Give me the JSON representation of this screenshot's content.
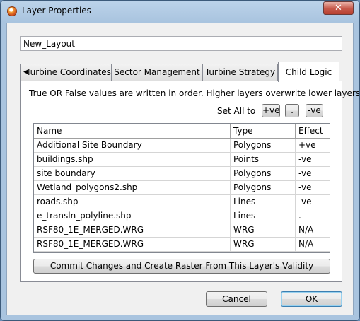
{
  "window": {
    "title": "Layer Properties",
    "close_glyph": "✕"
  },
  "layout_name": "New_Layout",
  "tabs": [
    {
      "label": "Turbine Coordinates",
      "active": false
    },
    {
      "label": "Sector Management",
      "active": false
    },
    {
      "label": "Turbine Strategy",
      "active": false
    },
    {
      "label": "Child Logic",
      "active": true
    }
  ],
  "tab_scroll_glyph": "◀",
  "child_logic": {
    "description": "True OR False values are written in order. Higher layers overwrite lower layers",
    "set_all_label": "Set All to",
    "set_buttons": [
      "+ve",
      ".",
      "-ve"
    ],
    "columns": [
      "Name",
      "Type",
      "Effect"
    ],
    "rows": [
      [
        "Additional Site Boundary",
        "Polygons",
        "+ve"
      ],
      [
        "buildings.shp",
        "Points",
        "-ve"
      ],
      [
        "site boundary",
        "Polygons",
        "-ve"
      ],
      [
        "Wetland_polygons2.shp",
        "Polygons",
        "-ve"
      ],
      [
        "roads.shp",
        "Lines",
        "-ve"
      ],
      [
        "e_transln_polyline.shp",
        "Lines",
        "."
      ],
      [
        "RSF80_1E_MERGED.WRG",
        "WRG",
        "N/A"
      ],
      [
        "RSF80_1E_MERGED.WRG",
        "WRG",
        "N/A"
      ]
    ],
    "commit_label": "Commit Changes and Create Raster From This Layer's Validity"
  },
  "footer": {
    "cancel_label": "Cancel",
    "ok_label": "OK"
  }
}
